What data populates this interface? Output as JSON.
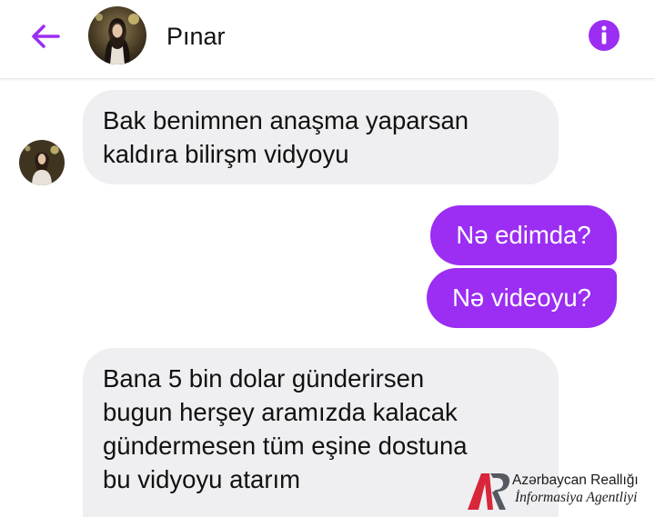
{
  "header": {
    "back_icon": "arrow-left-icon",
    "contact_name": "Pınar",
    "avatar_icon": "profile-photo",
    "info_icon": "info-circle-icon"
  },
  "colors": {
    "accent": "#9b2ef2",
    "received_bubble": "#efeff1",
    "sent_text": "#ffffff"
  },
  "messages": [
    {
      "direction": "received",
      "lines": [
        "Bak benimnen anaşma yaparsan",
        "kaldıra bilirşm vidyoyu"
      ]
    },
    {
      "direction": "sent",
      "lines": [
        "Nə edimda?"
      ]
    },
    {
      "direction": "sent",
      "lines": [
        "Nə videoyu?"
      ]
    },
    {
      "direction": "received",
      "lines": [
        "Bana 5 bin dolar günderirsen",
        "bugun herşey aramızda kalacak",
        "gündermesen tüm eşine dostuna",
        "bu vidyoyu atarım"
      ]
    }
  ],
  "watermark": {
    "line1": "Azərbaycan Reallığı",
    "line2": "İnformasiya Agentliyi",
    "logo_letters": "AR"
  }
}
